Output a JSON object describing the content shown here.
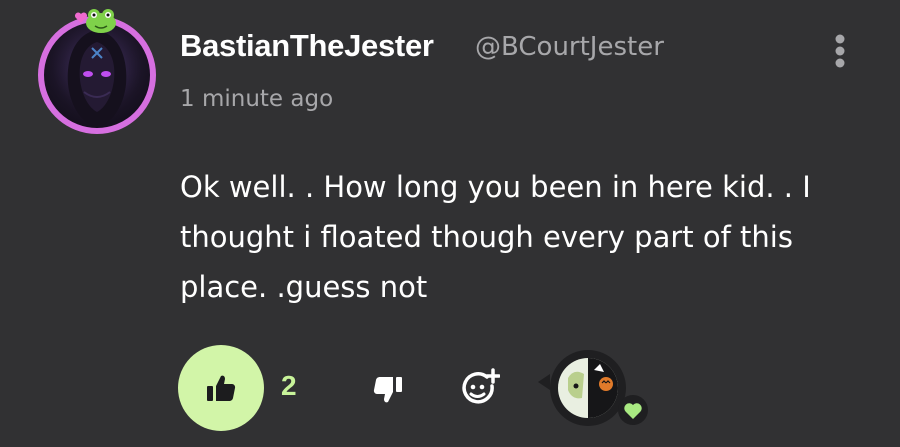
{
  "comment": {
    "author": {
      "display_name": "BastianTheJester",
      "handle": "@BCourtJester"
    },
    "timestamp": "1 minute ago",
    "body": "Ok well. . How long you been in here kid. . I thought i floated though every part of this place. .guess not",
    "actions": {
      "like_count": "2",
      "liked": true
    }
  },
  "colors": {
    "background": "#313133",
    "avatar_ring": "#d66fe0",
    "like_active": "#d2f5a8",
    "like_count": "#c8f39a",
    "secondary_text": "#a7a7aa",
    "reaction_heart": "#a9ea82"
  },
  "icons": {
    "more": "vertical-dots-icon",
    "like": "thumbs-up-icon",
    "dislike": "thumbs-down-icon",
    "react": "add-reaction-icon",
    "reaction_badge": "heart-icon"
  }
}
